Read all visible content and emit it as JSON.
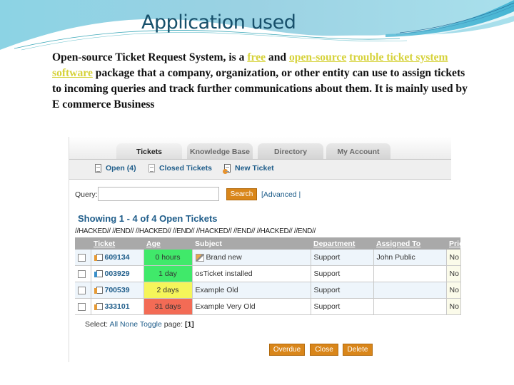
{
  "slide": {
    "title": "Application used",
    "body": {
      "intro": "Open-source Ticket Request System, is a ",
      "link_free": "free",
      "and": " and ",
      "link_open_source": "open-source",
      "link_trouble": "trouble ticket system",
      "link_software": "software",
      "rest": " package that a company, organization, or other entity can use to assign tickets to incoming queries and track further communications about them. It is mainly used by E commerce Business"
    }
  },
  "app": {
    "tabs": [
      {
        "label": "Tickets",
        "active": true
      },
      {
        "label": "Knowledge Base",
        "active": false
      },
      {
        "label": "Directory",
        "active": false
      },
      {
        "label": "My Account",
        "active": false
      }
    ],
    "subnav": [
      {
        "label": "Open (4)",
        "icon": "document-icon"
      },
      {
        "label": "Closed Tickets",
        "icon": "document-icon"
      },
      {
        "label": "New Ticket",
        "icon": "new-ticket-icon"
      }
    ],
    "query": {
      "label": "Query:",
      "value": "",
      "search_label": "Search",
      "advanced_label": "[Advanced |"
    },
    "showing": "Showing  1 - 4 of 4   Open Tickets",
    "hacked_text": "//HACKED//  //END//  //HACKED//  //END//  //HACKED//  //END//  //HACKED//  //END//",
    "table": {
      "columns": [
        "Ticket",
        "Age",
        "Subject",
        "Department",
        "Assigned To",
        "Prior"
      ],
      "rows": [
        {
          "ticket": "609134",
          "age": "0 hours",
          "age_color": "#40e96a",
          "subject": "Brand new",
          "subject_icon": true,
          "department": "Support",
          "assigned": "John Public",
          "priority": "No",
          "icon": "ticket-icon"
        },
        {
          "ticket": "003929",
          "age": "1 day",
          "age_color": "#40e96a",
          "subject": "osTicket installed",
          "subject_icon": false,
          "department": "Support",
          "assigned": "",
          "priority": "No",
          "icon": "ticket-checked-icon"
        },
        {
          "ticket": "700539",
          "age": "2 days",
          "age_color": "#f5f55a",
          "subject": "Example Old",
          "subject_icon": false,
          "department": "Support",
          "assigned": "",
          "priority": "No",
          "icon": "ticket-icon"
        },
        {
          "ticket": "333101",
          "age": "31 days",
          "age_color": "#f36b55",
          "subject": "Example Very Old",
          "subject_icon": false,
          "department": "Support",
          "assigned": "",
          "priority": "No",
          "icon": "ticket-icon"
        }
      ]
    },
    "select": {
      "label": "Select: ",
      "all": "All",
      "none": "None",
      "toggle": "Toggle",
      "page_label": " page: ",
      "page": "[1]"
    },
    "actions": {
      "overdue": "Overdue",
      "close": "Close",
      "delete": "Delete"
    }
  },
  "colors": {
    "link_yellow": "#d6d23a",
    "title_teal": "#17506b",
    "app_blue": "#1f5d8a",
    "button_orange": "#d9861a"
  }
}
